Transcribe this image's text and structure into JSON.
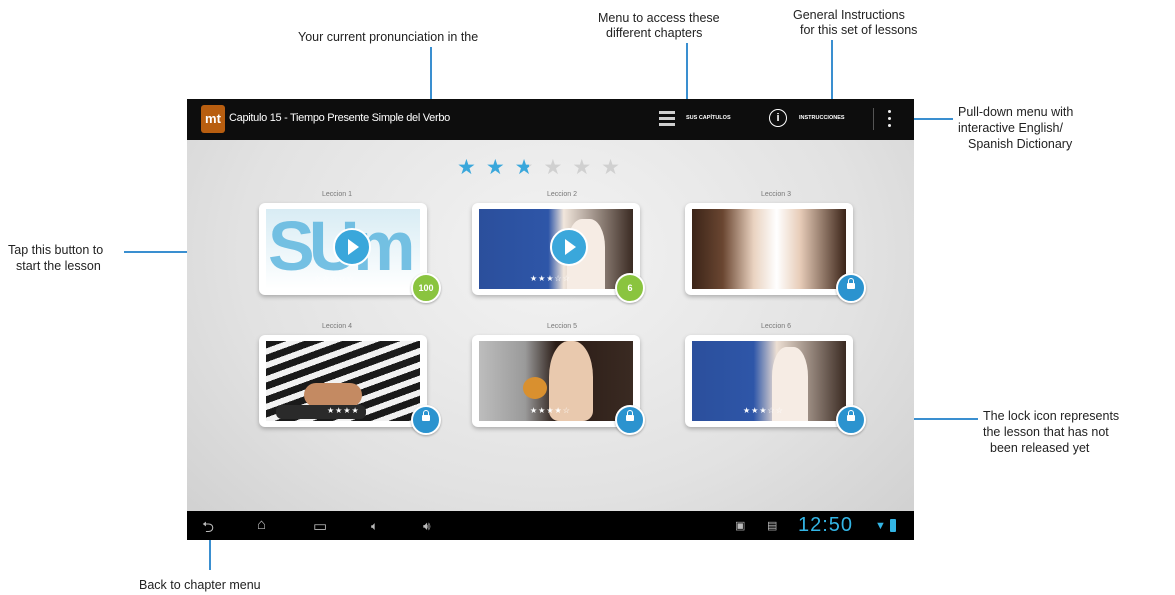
{
  "app": {
    "logo_text": "mt",
    "title": "Capitulo 15 - Tiempo Presente Simple del Verbo",
    "chapters_label": "SUS CAPÍTULOS",
    "instructions_label": "INSTRUCCIONES"
  },
  "rating": {
    "filled": 2.5,
    "total": 6
  },
  "lessons": [
    {
      "label": "Leccion 1",
      "score": "100",
      "status": "playable"
    },
    {
      "label": "Leccion 2",
      "score": "6",
      "status": "playable"
    },
    {
      "label": "Leccion 3",
      "status": "locked"
    },
    {
      "label": "Leccion 4",
      "status": "locked"
    },
    {
      "label": "Leccion 5",
      "status": "locked"
    },
    {
      "label": "Leccion 6",
      "status": "locked"
    }
  ],
  "status_bar": {
    "clock": "12:50"
  },
  "annotations": {
    "pronunciation": "Your current pronunciation in the",
    "chapters_menu_line1": "Menu to access these",
    "chapters_menu_line2": "different chapters",
    "instructions_line1": "General Instructions",
    "instructions_line2": "for this set of lessons",
    "dictionary_line1": "Pull-down menu with",
    "dictionary_line2": "interactive English/",
    "dictionary_line3": "Spanish Dictionary",
    "start_line1": "Tap this button to",
    "start_line2": "start the lesson",
    "lock_line1": "The lock icon represents",
    "lock_line2": "the lesson that has not",
    "lock_line3": "been released yet",
    "back": "Back to chapter menu"
  },
  "colors": {
    "accent": "#3aa7db",
    "score_badge": "#8ac43f",
    "lock_badge": "#2b93cf",
    "annotation_line": "#3a8fd0"
  }
}
